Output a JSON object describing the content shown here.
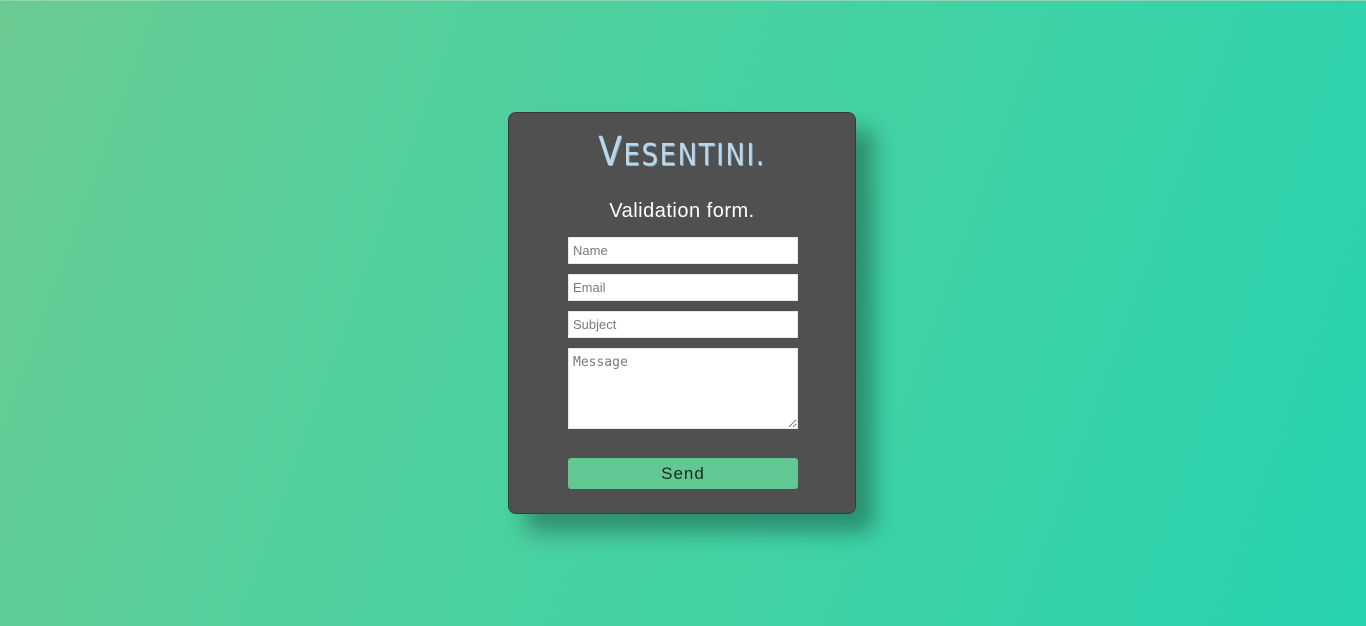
{
  "brand": {
    "logo_cap": "V",
    "logo_rest": "ESENTINI."
  },
  "form": {
    "title": "Validation form.",
    "name_placeholder": "Name",
    "email_placeholder": "Email",
    "subject_placeholder": "Subject",
    "message_placeholder": "Message",
    "send_label": "Send"
  },
  "colors": {
    "background_start": "#6cca92",
    "background_end": "#27d2ae",
    "card": "#505050",
    "logo": "#b9d8ec",
    "button": "#62c893"
  }
}
